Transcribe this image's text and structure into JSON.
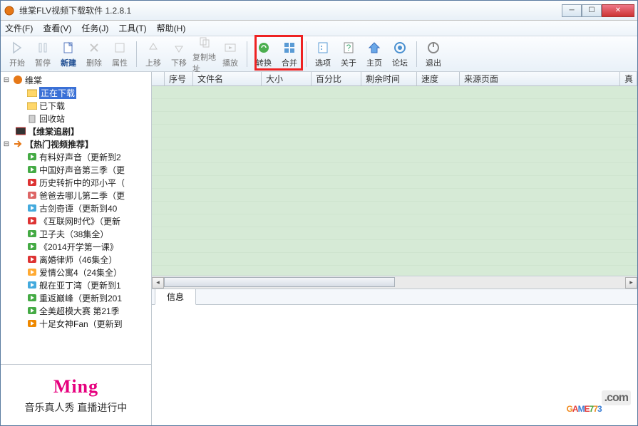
{
  "window": {
    "title": "维棠FLV视频下载软件 1.2.8.1"
  },
  "menu": {
    "file": "文件(F)",
    "view": "查看(V)",
    "task": "任务(J)",
    "tools": "工具(T)",
    "help": "帮助(H)"
  },
  "toolbar": {
    "start": "开始",
    "pause": "暂停",
    "new": "新建",
    "delete": "删除",
    "props": "属性",
    "up": "上移",
    "down": "下移",
    "copyaddr": "复制地址",
    "play": "播放",
    "convert": "转换",
    "merge": "合并",
    "options": "选项",
    "about": "关于",
    "home": "主页",
    "forum": "论坛",
    "exit": "退出"
  },
  "tree": {
    "root": "维棠",
    "downloading": "正在下载",
    "downloaded": "已下载",
    "recycle": "回收站",
    "drama": "【维棠追剧】",
    "hot": "【热门视频推荐】",
    "items": [
      "有料好声音（更新到2",
      "中国好声音第三季（更",
      "历史转折中的邓小平（",
      "爸爸去哪儿第二季（更",
      "古剑奇谭（更新到40",
      "《互联网时代》（更新",
      "卫子夫（38集全）",
      "《2014开学第一课》",
      "离婚律师（46集全）",
      "爱情公寓4（24集全）",
      "舰在亚丁湾（更新到1",
      "重返巅峰（更新到201",
      "全美超模大赛 第21季",
      "十足女神Fan（更新到"
    ]
  },
  "columns": {
    "seq": "序号",
    "filename": "文件名",
    "size": "大小",
    "percent": "百分比",
    "remain": "剩余时间",
    "speed": "速度",
    "source": "来源页面",
    "last": "真"
  },
  "info": {
    "tab": "信息"
  },
  "banner": {
    "logo": "Ming",
    "text": "音乐真人秀 直播进行中"
  },
  "watermark": {
    "text": "GAME773",
    "suffix": ".com"
  }
}
